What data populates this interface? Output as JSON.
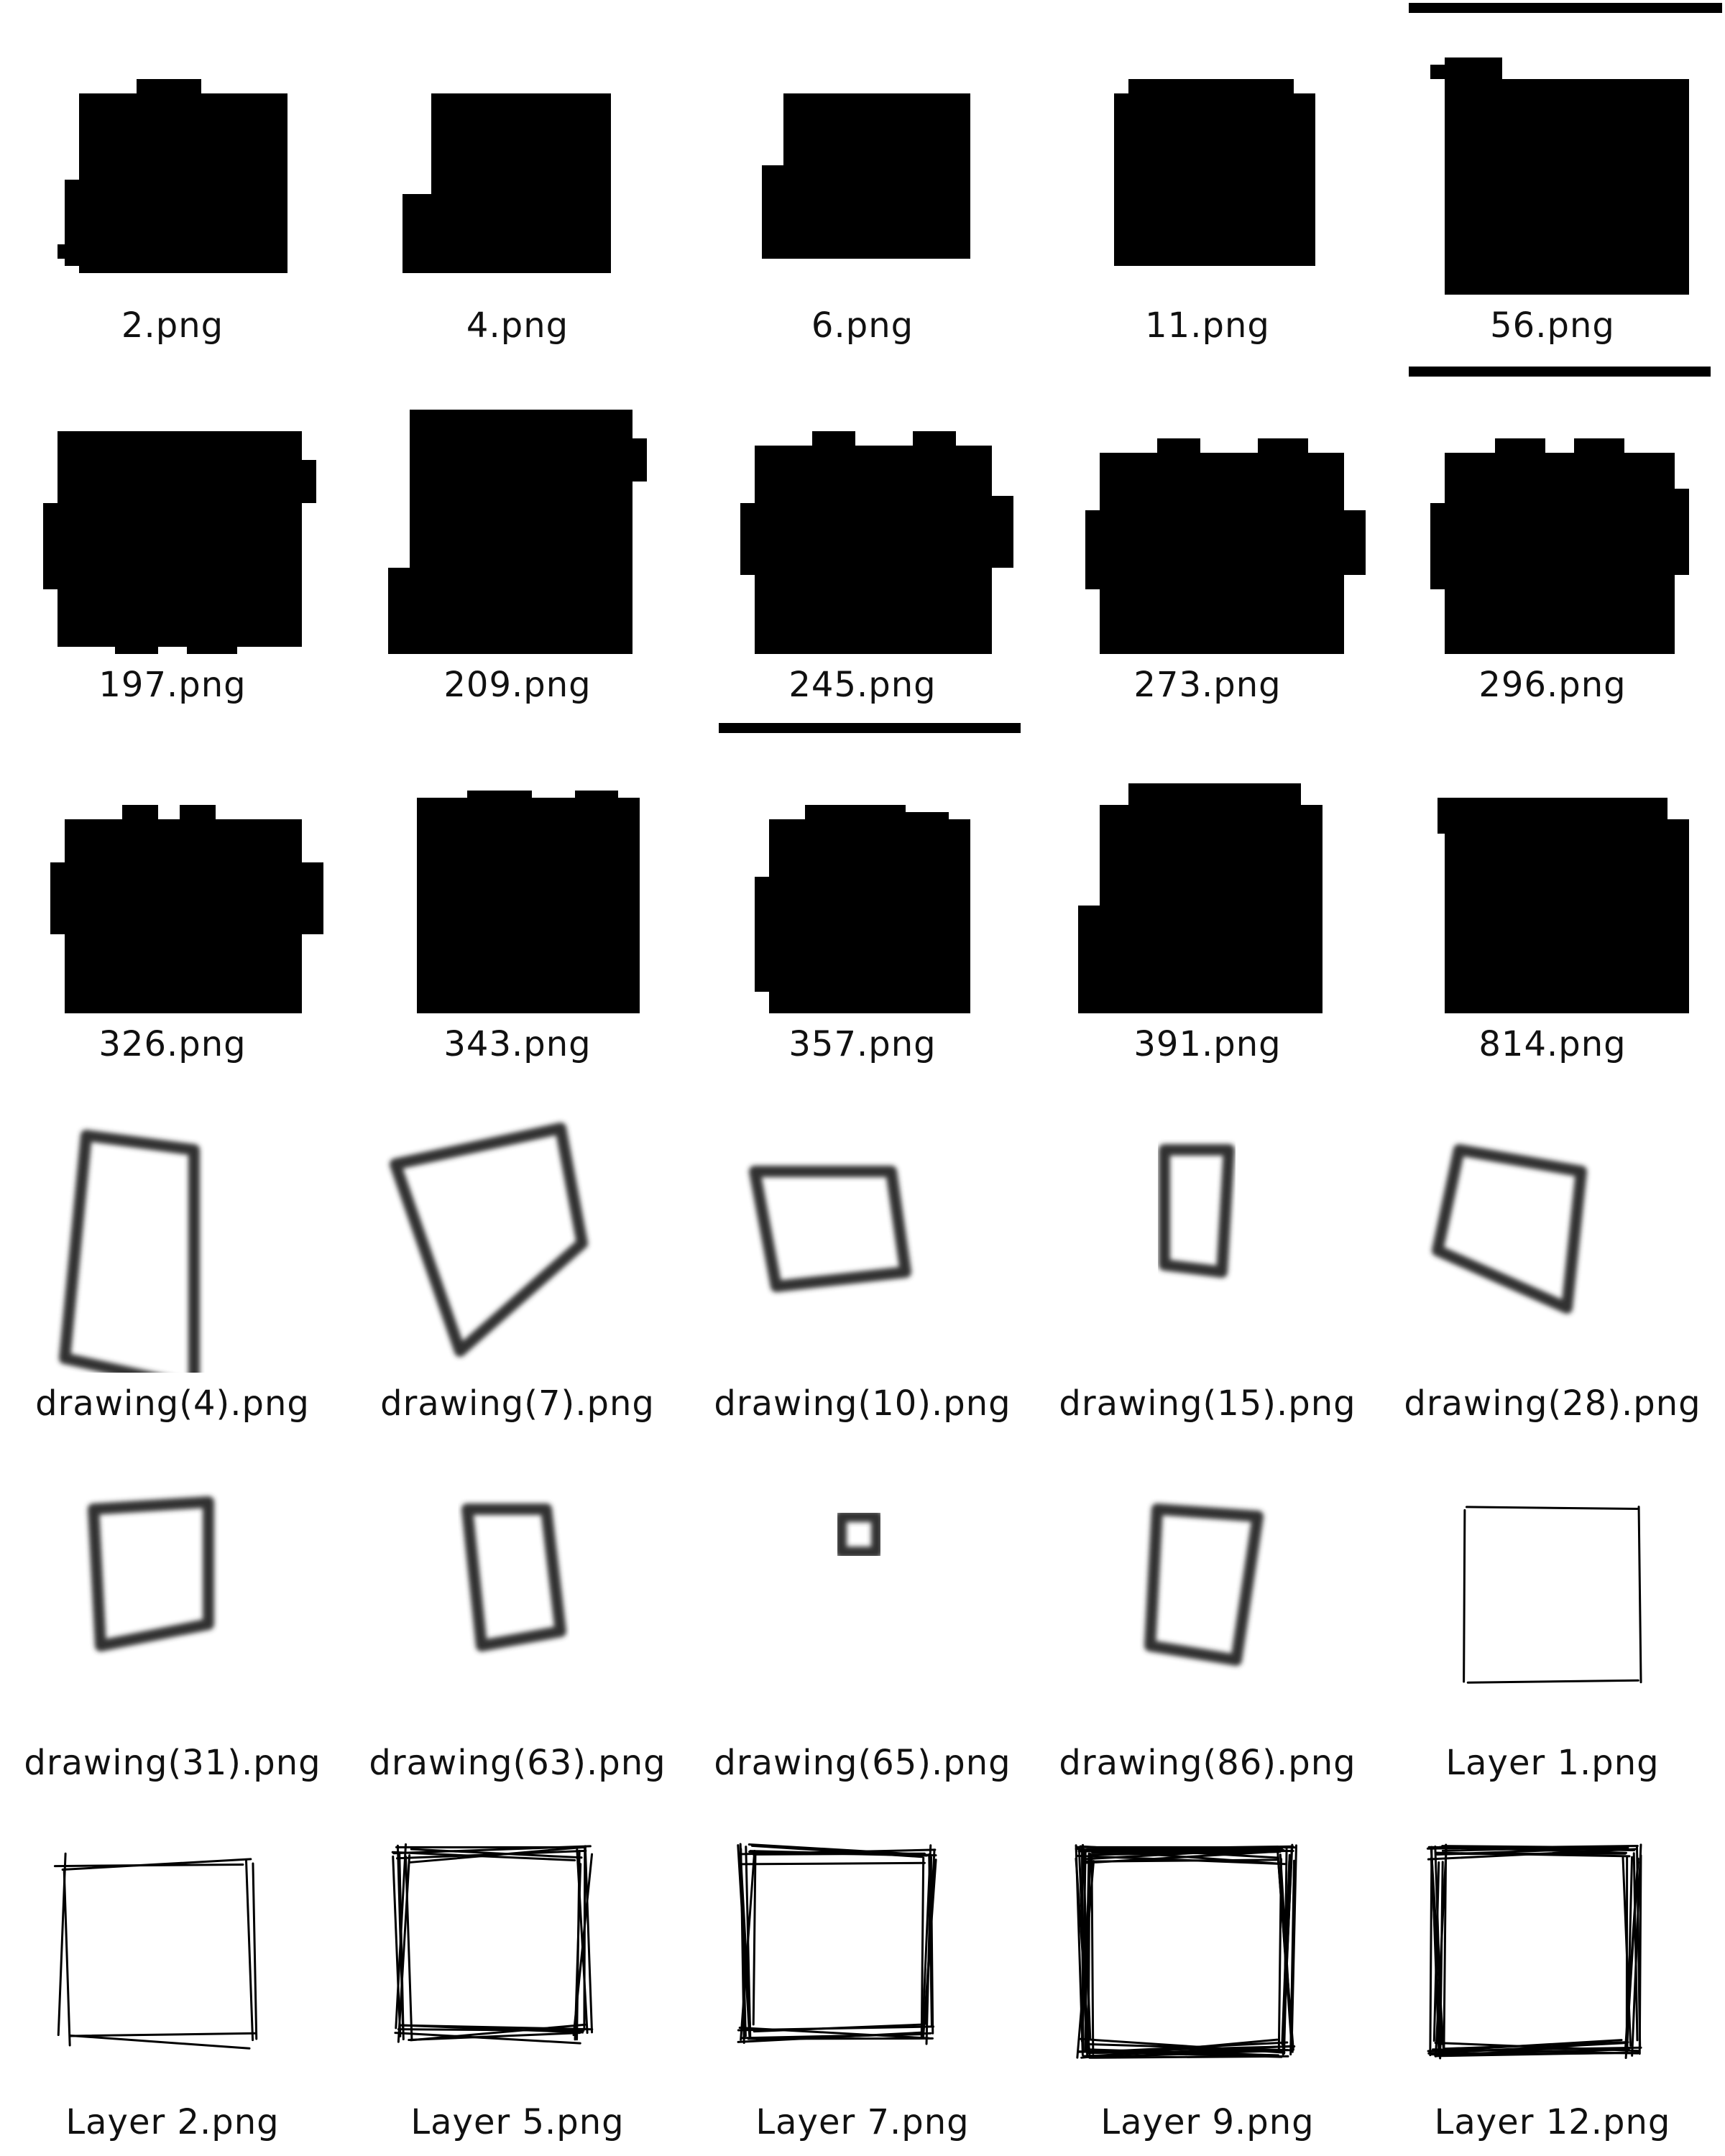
{
  "gallery": {
    "items": [
      {
        "filename": "2.png",
        "style": "blob",
        "variant": 0
      },
      {
        "filename": "4.png",
        "style": "blob",
        "variant": 1
      },
      {
        "filename": "6.png",
        "style": "blob",
        "variant": 2
      },
      {
        "filename": "11.png",
        "style": "blob",
        "variant": 3
      },
      {
        "filename": "56.png",
        "style": "blob",
        "variant": 4
      },
      {
        "filename": "197.png",
        "style": "blob",
        "variant": 5
      },
      {
        "filename": "209.png",
        "style": "blob",
        "variant": 6
      },
      {
        "filename": "245.png",
        "style": "blob",
        "variant": 7
      },
      {
        "filename": "273.png",
        "style": "blob",
        "variant": 8
      },
      {
        "filename": "296.png",
        "style": "blob",
        "variant": 9
      },
      {
        "filename": "326.png",
        "style": "blob",
        "variant": 10
      },
      {
        "filename": "343.png",
        "style": "blob",
        "variant": 11
      },
      {
        "filename": "357.png",
        "style": "blob",
        "variant": 12
      },
      {
        "filename": "391.png",
        "style": "blob",
        "variant": 13
      },
      {
        "filename": "814.png",
        "style": "blob",
        "variant": 14
      },
      {
        "filename": "drawing(4).png",
        "style": "outline",
        "variant": 0
      },
      {
        "filename": "drawing(7).png",
        "style": "outline",
        "variant": 1
      },
      {
        "filename": "drawing(10).png",
        "style": "outline",
        "variant": 2
      },
      {
        "filename": "drawing(15).png",
        "style": "outline",
        "variant": 3
      },
      {
        "filename": "drawing(28).png",
        "style": "outline",
        "variant": 4
      },
      {
        "filename": "drawing(31).png",
        "style": "outline",
        "variant": 5
      },
      {
        "filename": "drawing(63).png",
        "style": "outline",
        "variant": 6
      },
      {
        "filename": "drawing(65).png",
        "style": "outline",
        "variant": 7
      },
      {
        "filename": "drawing(86).png",
        "style": "outline",
        "variant": 8
      },
      {
        "filename": "Layer 1.png",
        "style": "sketch",
        "variant": 0
      },
      {
        "filename": "Layer 2.png",
        "style": "sketch",
        "variant": 1
      },
      {
        "filename": "Layer 5.png",
        "style": "sketch",
        "variant": 2
      },
      {
        "filename": "Layer 7.png",
        "style": "sketch",
        "variant": 3
      },
      {
        "filename": "Layer 9.png",
        "style": "sketch",
        "variant": 4
      },
      {
        "filename": "Layer 12.png",
        "style": "sketch",
        "variant": 5
      }
    ]
  },
  "colors": {
    "background": "#ffffff",
    "ink": "#000000",
    "outline_stroke": "#333333",
    "caption_text": "#111111"
  }
}
